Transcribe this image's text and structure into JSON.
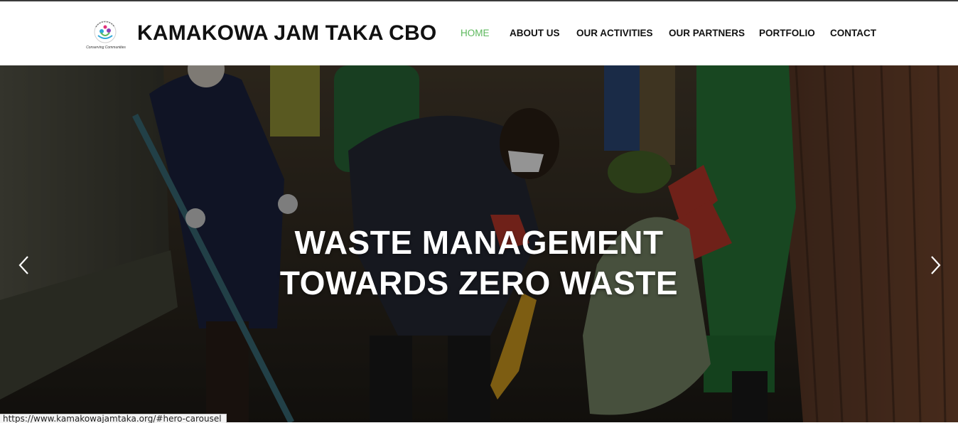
{
  "header": {
    "logo_icon": "kamakowa-jam-taka-logo",
    "logo_caption": "Conserving Communities",
    "site_title": "KAMAKOWA JAM TAKA CBO"
  },
  "nav": {
    "items": [
      {
        "label": "HOME",
        "active": true
      },
      {
        "label": "ABOUT US",
        "active": false
      },
      {
        "label": "OUR ACTIVITIES",
        "active": false
      },
      {
        "label": "OUR PARTNERS",
        "active": false
      },
      {
        "label": "PORTFOLIO",
        "active": false
      },
      {
        "label": "CONTACT",
        "active": false
      }
    ],
    "active_color": "#5cb85c"
  },
  "hero": {
    "title_line1": "WASTE MANAGEMENT",
    "title_line2": "TOWARDS ZERO WASTE",
    "prev_icon": "chevron-left-icon",
    "next_icon": "chevron-right-icon"
  },
  "status_bar": {
    "url": "https://www.kamakowajamtaka.org/#hero-carousel"
  }
}
